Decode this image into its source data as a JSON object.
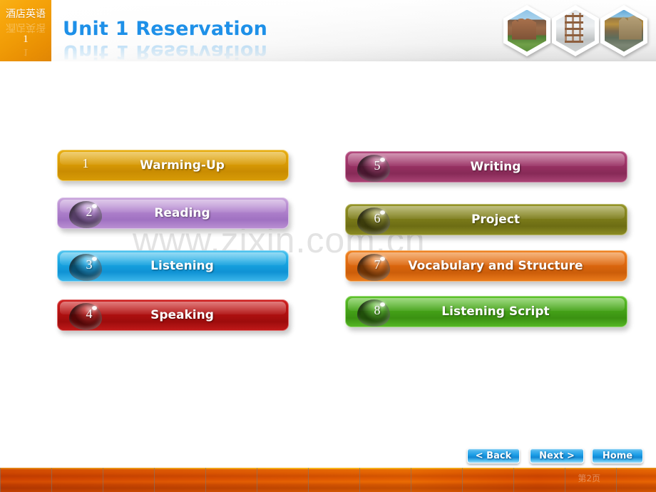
{
  "header": {
    "badge_text": "酒店英语",
    "badge_number": "1",
    "title": "Unit 1 Reservation",
    "hex_images": [
      {
        "name": "hex-photo-cathedral"
      },
      {
        "name": "hex-photo-scaffold-building"
      },
      {
        "name": "hex-photo-campus-autumn"
      }
    ]
  },
  "watermark": "www.zixin.com.cn",
  "menu": {
    "left_column": [
      {
        "number": "1",
        "label": "Warming-Up",
        "color": "#d99a06",
        "has_bubble": false
      },
      {
        "number": "2",
        "label": "Reading",
        "color": "#b07fcb",
        "has_bubble": true
      },
      {
        "number": "3",
        "label": "Listening",
        "color": "#22a8e0",
        "has_bubble": true
      },
      {
        "number": "4",
        "label": "Speaking",
        "color": "#b81414",
        "has_bubble": true
      }
    ],
    "right_column": [
      {
        "number": "5",
        "label": "Writing",
        "color": "#9d3367",
        "has_bubble": true
      },
      {
        "number": "6",
        "label": "Project",
        "color": "#80801c",
        "has_bubble": true
      },
      {
        "number": "7",
        "label": "Vocabulary and Structure",
        "color": "#e06a10",
        "has_bubble": true
      },
      {
        "number": "8",
        "label": "Listening Script",
        "color": "#4aa81c",
        "has_bubble": true
      }
    ]
  },
  "nav": {
    "back": "< Back",
    "next": "Next >",
    "home": "Home"
  },
  "footer": {
    "page_label": "第2页"
  }
}
